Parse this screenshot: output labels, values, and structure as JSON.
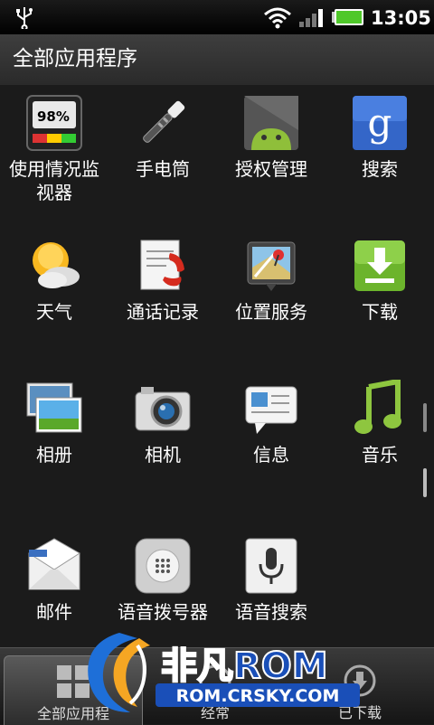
{
  "status_bar": {
    "time": "13:05",
    "icons": [
      "usb-icon",
      "wifi-icon",
      "signal-icon",
      "battery-icon"
    ]
  },
  "title": "全部应用程序",
  "apps": [
    {
      "label": "使用情况监视器",
      "icon": "usage-monitor-icon",
      "gauge_text": "98%"
    },
    {
      "label": "手电筒",
      "icon": "flashlight-icon"
    },
    {
      "label": "授权管理",
      "icon": "android-auth-icon"
    },
    {
      "label": "搜索",
      "icon": "google-search-icon",
      "glyph": "g"
    },
    {
      "label": "天气",
      "icon": "weather-icon"
    },
    {
      "label": "通话记录",
      "icon": "call-log-icon"
    },
    {
      "label": "位置服务",
      "icon": "location-icon"
    },
    {
      "label": "下载",
      "icon": "download-icon"
    },
    {
      "label": "相册",
      "icon": "gallery-icon"
    },
    {
      "label": "相机",
      "icon": "camera-icon"
    },
    {
      "label": "信息",
      "icon": "messages-icon"
    },
    {
      "label": "音乐",
      "icon": "music-icon"
    },
    {
      "label": "邮件",
      "icon": "mail-icon"
    },
    {
      "label": "语音拨号器",
      "icon": "voice-dialer-icon"
    },
    {
      "label": "语音搜索",
      "icon": "voice-search-icon"
    }
  ],
  "bottom_tabs": [
    {
      "label": "全部应用程",
      "icon": "all-apps-icon",
      "selected": true
    },
    {
      "label": "经常",
      "icon": "frequent-icon",
      "selected": false
    },
    {
      "label": "已下载",
      "icon": "downloaded-icon",
      "selected": false
    }
  ],
  "watermark": {
    "brand": "非凡ROM",
    "url": "ROM.CRSKY.COM"
  },
  "colors": {
    "background": "#1b1b1b",
    "titlebar": "#333333",
    "battery": "#4fc82a",
    "accent_green": "#8ec63f"
  }
}
